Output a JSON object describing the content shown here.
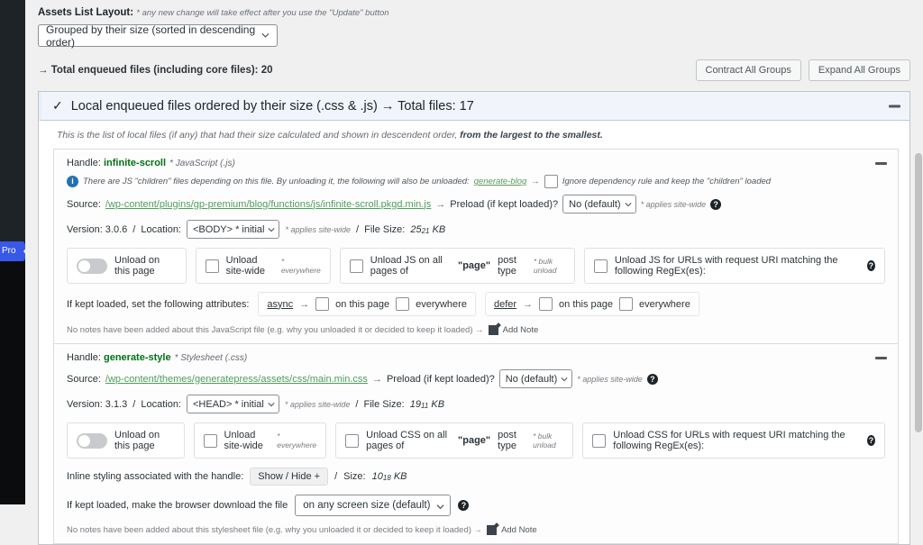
{
  "sidebar": {
    "pro_label": "Pro"
  },
  "toolbar": {
    "layout_label": "Assets List Layout:",
    "layout_note": "* any new change will take effect after you use the \"Update\" button",
    "layout_value": "Grouped by their size (sorted in descending order)",
    "total_enqueued": "→ Total enqueued files (including core files): 20",
    "contract_all": "Contract All Groups",
    "expand_all": "Expand All Groups"
  },
  "group": {
    "check_icon": "check-icon",
    "title": "Local enqueued files ordered by their size (.css & .js) → Total files: 17",
    "description_plain": "This is the list of local files (if any) that had their size calculated and shown in descendent order, ",
    "description_bold": "from the largest to the smallest.",
    "collapse_icon": "minus-icon"
  },
  "assets": [
    {
      "handle_label": "Handle:",
      "handle_name": "infinite-scroll",
      "type_note": "* JavaScript (.js)",
      "dependency_notice": "There are JS \"children\" files depending on this file. By unloading it, the following will also be unloaded:",
      "dependency_link": "generate-blog",
      "dependency_arrow": "→",
      "dependency_checkbox_label": "Ignore dependency rule and keep the \"children\" loaded",
      "source_label": "Source:",
      "source_url": "/wp-content/plugins/gp-premium/blog/functions/js/infinite-scroll.pkgd.min.js",
      "preload_label": "Preload (if kept loaded)?",
      "preload_value": "No (default)",
      "preload_note": "* applies site-wide",
      "version_label": "Version: 3.0.6",
      "separator": "/",
      "location_label": "Location:",
      "location_value": "<BODY> * initial",
      "location_note": "* applies site-wide",
      "filesize_label": "File Size:",
      "filesize_value": "25",
      "filesize_decimals": "21",
      "filesize_unit": "KB",
      "toggle_label": "Unload on this page",
      "sitewide_label": "Unload site-wide",
      "sitewide_note": "* everywhere",
      "bulk_prefix": "Unload JS on all pages of",
      "bulk_quoted": "\"page\"",
      "bulk_suffix": "post type",
      "bulk_note": "* bulk unload",
      "regex_label": "Unload JS for URLs with request URI matching the following RegEx(es):",
      "attributes_label": "If kept loaded, set the following attributes:",
      "async_keyword": "async",
      "async_this_page": "on this page",
      "async_everywhere": "everywhere",
      "defer_keyword": "defer",
      "defer_this_page": "on this page",
      "defer_everywhere": "everywhere",
      "notes_text": "No notes have been added about this JavaScript file (e.g. why you unloaded it or decided to keep it loaded) →",
      "add_note": "Add Note"
    },
    {
      "handle_label": "Handle:",
      "handle_name": "generate-style",
      "type_note": "* Stylesheet (.css)",
      "source_label": "Source:",
      "source_url": "/wp-content/themes/generatepress/assets/css/main.min.css",
      "preload_label": "Preload (if kept loaded)?",
      "preload_value": "No (default)",
      "preload_note": "* applies site-wide",
      "version_label": "Version: 3.1.3",
      "separator": "/",
      "location_label": "Location:",
      "location_value": "<HEAD> * initial",
      "location_note": "* applies site-wide",
      "filesize_label": "File Size:",
      "filesize_value": "19",
      "filesize_decimals": "11",
      "filesize_unit": "KB",
      "toggle_label": "Unload on this page",
      "sitewide_label": "Unload site-wide",
      "sitewide_note": "* everywhere",
      "bulk_prefix": "Unload CSS on all pages of",
      "bulk_quoted": "\"page\"",
      "bulk_suffix": "post type",
      "bulk_note": "* bulk unload",
      "regex_label": "Unload CSS for URLs with request URI matching the following RegEx(es):",
      "inline_label": "Inline styling associated with the handle:",
      "show_hide": "Show / Hide +",
      "inline_size_label": "Size:",
      "inline_size_value": "10",
      "inline_size_decimals": "18",
      "inline_size_unit": "KB",
      "screen_label": "If kept loaded, make the browser download the file",
      "screen_value": "on any screen size (default)",
      "notes_text": "No notes have been added about this stylesheet file (e.g. why you unloaded it or decided to keep it loaded) →",
      "add_note": "Add Note"
    }
  ],
  "colors": {
    "accent_blue": "#3858e9",
    "handle_green": "#007017",
    "link_green": "#4f9d5b",
    "panel_head": "#f1f5fb"
  }
}
